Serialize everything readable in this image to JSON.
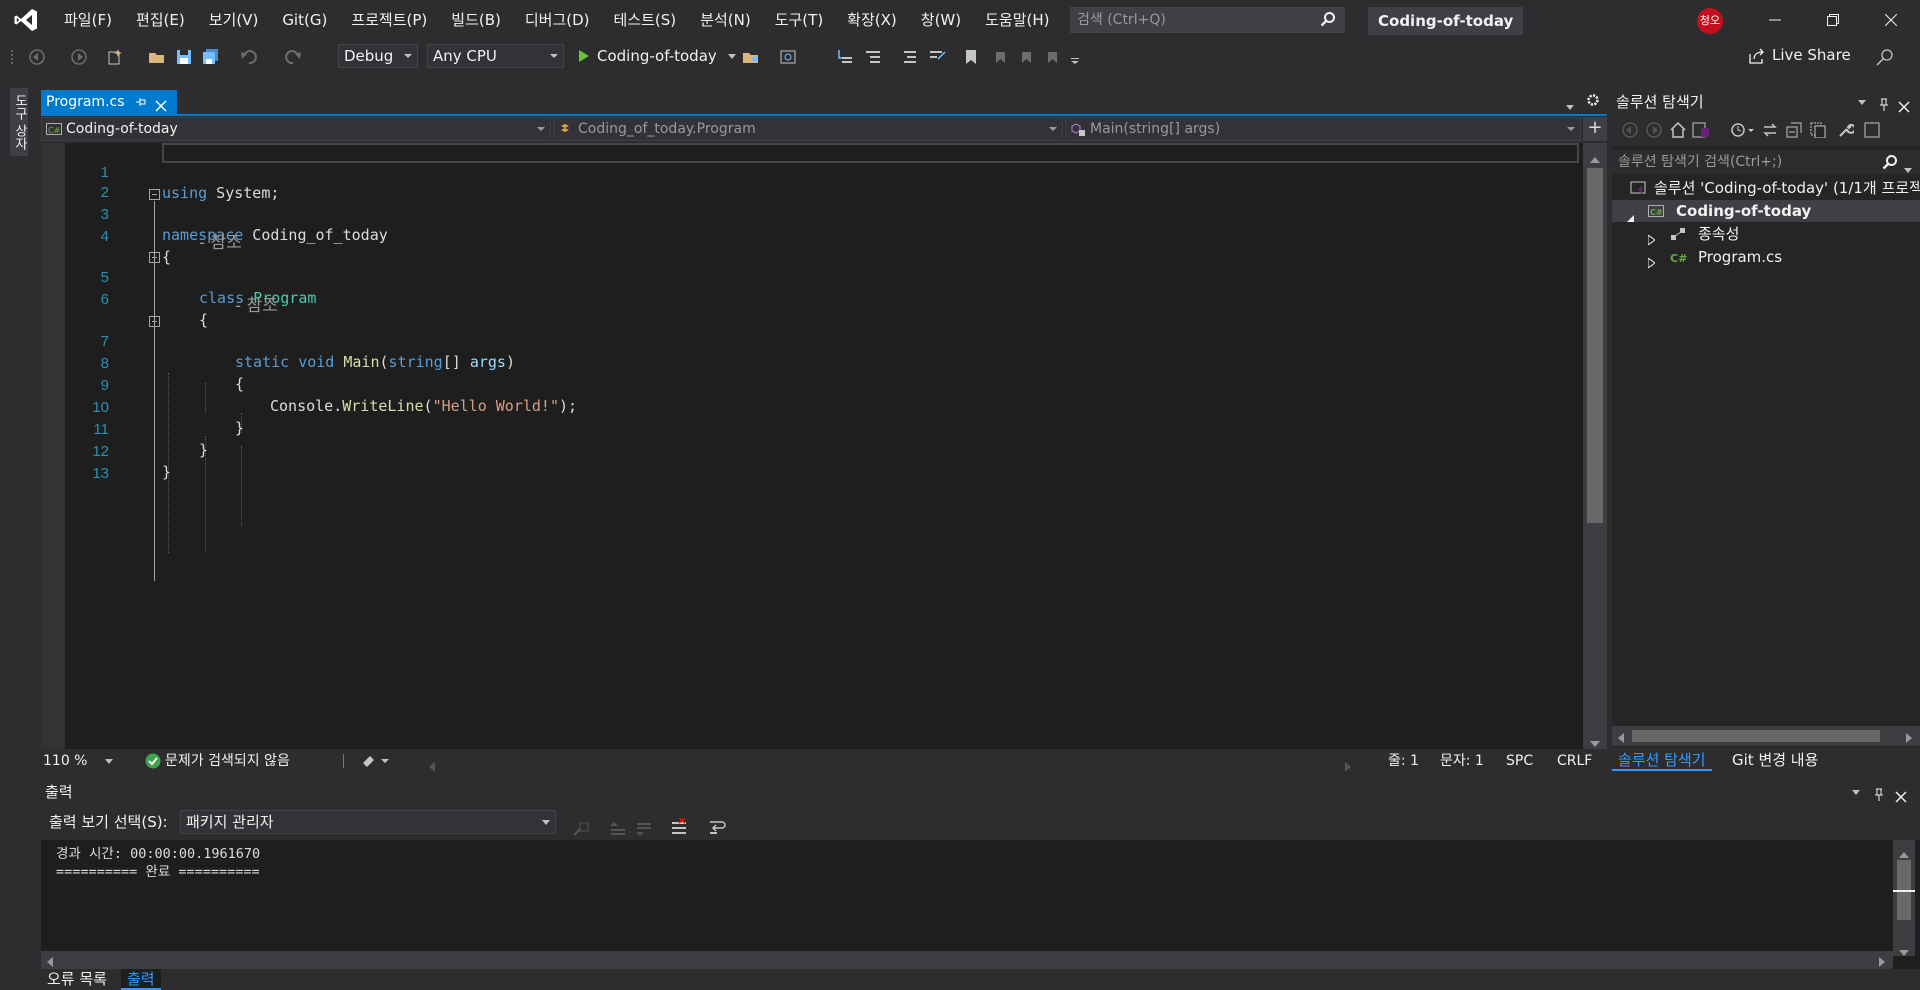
{
  "menu": [
    "파일(F)",
    "편집(E)",
    "보기(V)",
    "Git(G)",
    "프로젝트(P)",
    "빌드(B)",
    "디버그(D)",
    "테스트(S)",
    "분석(N)",
    "도구(T)",
    "확장(X)",
    "창(W)",
    "도움말(H)"
  ],
  "search": {
    "placeholder": "검색 (Ctrl+Q)"
  },
  "solution_name": "Coding-of-today",
  "avatar": "청오",
  "toolbar": {
    "config": "Debug",
    "platform": "Any CPU",
    "run_target": "Coding-of-today",
    "live_share": "Live Share"
  },
  "side_tab": "도구 상자",
  "tab": {
    "name": "Program.cs"
  },
  "navbar": {
    "project": "Coding-of-today",
    "type": "Coding_of_today.Program",
    "member": "Main(string[] args)"
  },
  "code": {
    "line_numbers": [
      "1",
      "2",
      "3",
      "4",
      "5",
      "6",
      "7",
      "8",
      "9",
      "10",
      "11",
      "12",
      "13"
    ],
    "l1": {
      "kw": "using",
      "rest": " System;"
    },
    "l3": {
      "kw": "namespace",
      "rest": " Coding_of_today"
    },
    "brace_open": "{",
    "brace_close": "}",
    "ref_label": "- 참조",
    "l5": {
      "kw": "class",
      "type": "Program"
    },
    "l7": {
      "kw1": "static",
      "kw2": "void",
      "fn": "Main",
      "open": "(",
      "kw3": "string",
      "arr": "[] ",
      "param": "args",
      "close": ")"
    },
    "l9": {
      "obj": "Console",
      "dot": ".",
      "fn": "WriteLine",
      "open": "(",
      "str": "\"Hello World!\"",
      "close": ");"
    }
  },
  "editor_status": {
    "zoom": "110 %",
    "issues": "문제가 검색되지 않음",
    "line": "줄: 1",
    "char": "문자: 1",
    "spc": "SPC",
    "crlf": "CRLF"
  },
  "solution_explorer": {
    "title": "솔루션 탐색기",
    "search_placeholder": "솔루션 탐색기 검색(Ctrl+;)",
    "solution_item": "솔루션 'Coding-of-today' (1/1개 프로젝트)",
    "project_item": "Coding-of-today",
    "deps_item": "종속성",
    "file_item": "Program.cs",
    "tab_active": "솔루션 탐색기",
    "tab_git": "Git 변경 내용"
  },
  "output": {
    "title": "출력",
    "source_label": "출력 보기 선택(S):",
    "source_value": "패키지 관리자",
    "lines": [
      "경과 시간: 00:00:00.1961670",
      "========== 완료 =========="
    ]
  },
  "bottom_tabs": {
    "errors": "오류 목록",
    "output": "출력"
  },
  "colors": {
    "accent": "#007acc",
    "keyword": "#569cd6",
    "type": "#4ec9b0",
    "method": "#dcdcaa",
    "string": "#d69d85",
    "line_number": "#2b91af"
  }
}
